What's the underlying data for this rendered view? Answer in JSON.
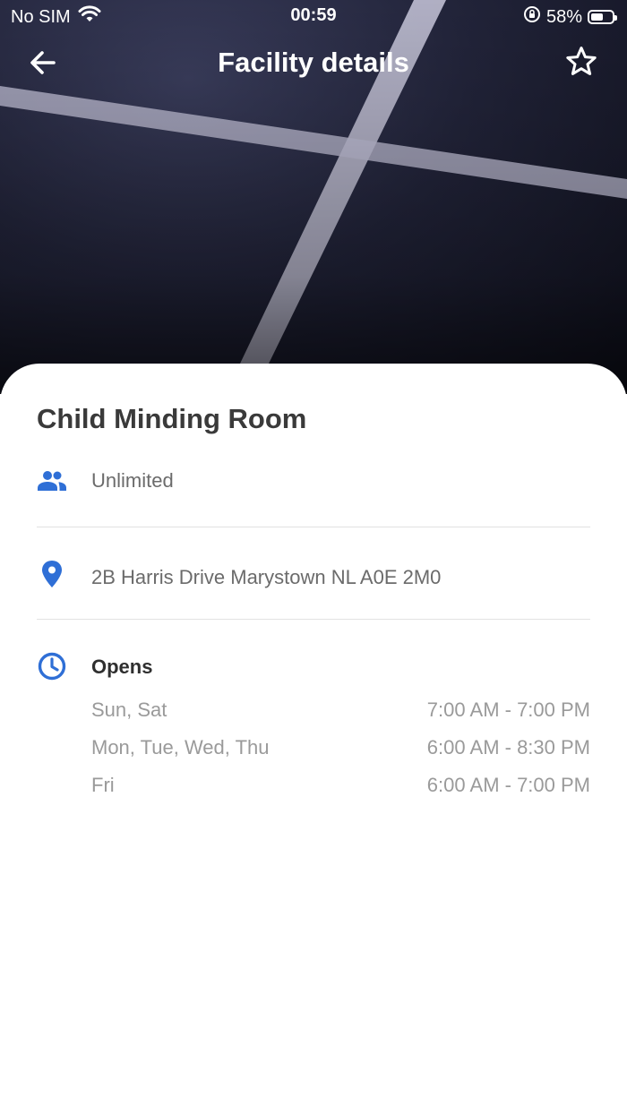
{
  "status_bar": {
    "carrier": "No SIM",
    "time": "00:59",
    "battery": "58%",
    "battery_level": 0.58
  },
  "nav": {
    "title": "Facility details"
  },
  "facility": {
    "name": "Child Minding Room",
    "capacity": "Unlimited",
    "address": "2B Harris Drive Marystown NL A0E 2M0",
    "opens_label": "Opens",
    "hours": [
      {
        "days": "Sun, Sat",
        "time": "7:00 AM - 7:00 PM"
      },
      {
        "days": "Mon, Tue, Wed, Thu",
        "time": "6:00 AM - 8:30 PM"
      },
      {
        "days": "Fri",
        "time": "6:00 AM - 7:00 PM"
      }
    ]
  },
  "colors": {
    "accent": "#2f6fd6",
    "hero_dark": "#1c1d2e"
  },
  "icons": {
    "back": "arrow-left-icon",
    "favorite": "star-outline-icon",
    "capacity": "people-icon",
    "location": "location-pin-icon",
    "hours": "clock-icon",
    "wifi": "wifi-icon",
    "rotation_lock": "rotation-lock-icon",
    "battery": "battery-icon"
  }
}
